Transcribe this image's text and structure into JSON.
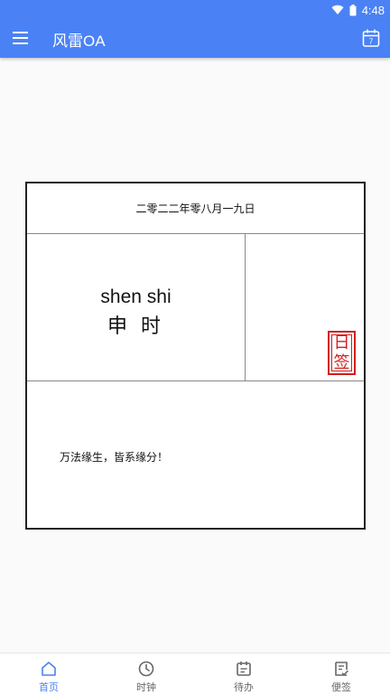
{
  "status_bar": {
    "time": "4:48"
  },
  "app_bar": {
    "title": "风雷OA",
    "calendar_day": "7"
  },
  "card": {
    "date": "二零二二年零八月一九日",
    "shichen_pinyin": "shen shi",
    "shichen": "申 时",
    "seal_chars": [
      "日",
      "签"
    ],
    "quote": "万法缘生，皆系缘分！"
  },
  "bottom_nav": {
    "items": [
      {
        "label": "首页",
        "icon": "home-icon",
        "active": true
      },
      {
        "label": "时钟",
        "icon": "clock-icon",
        "active": false
      },
      {
        "label": "待办",
        "icon": "todo-icon",
        "active": false
      },
      {
        "label": "便签",
        "icon": "note-icon",
        "active": false
      }
    ]
  },
  "colors": {
    "primary": "#4a82f5",
    "seal": "#d21f1f"
  }
}
